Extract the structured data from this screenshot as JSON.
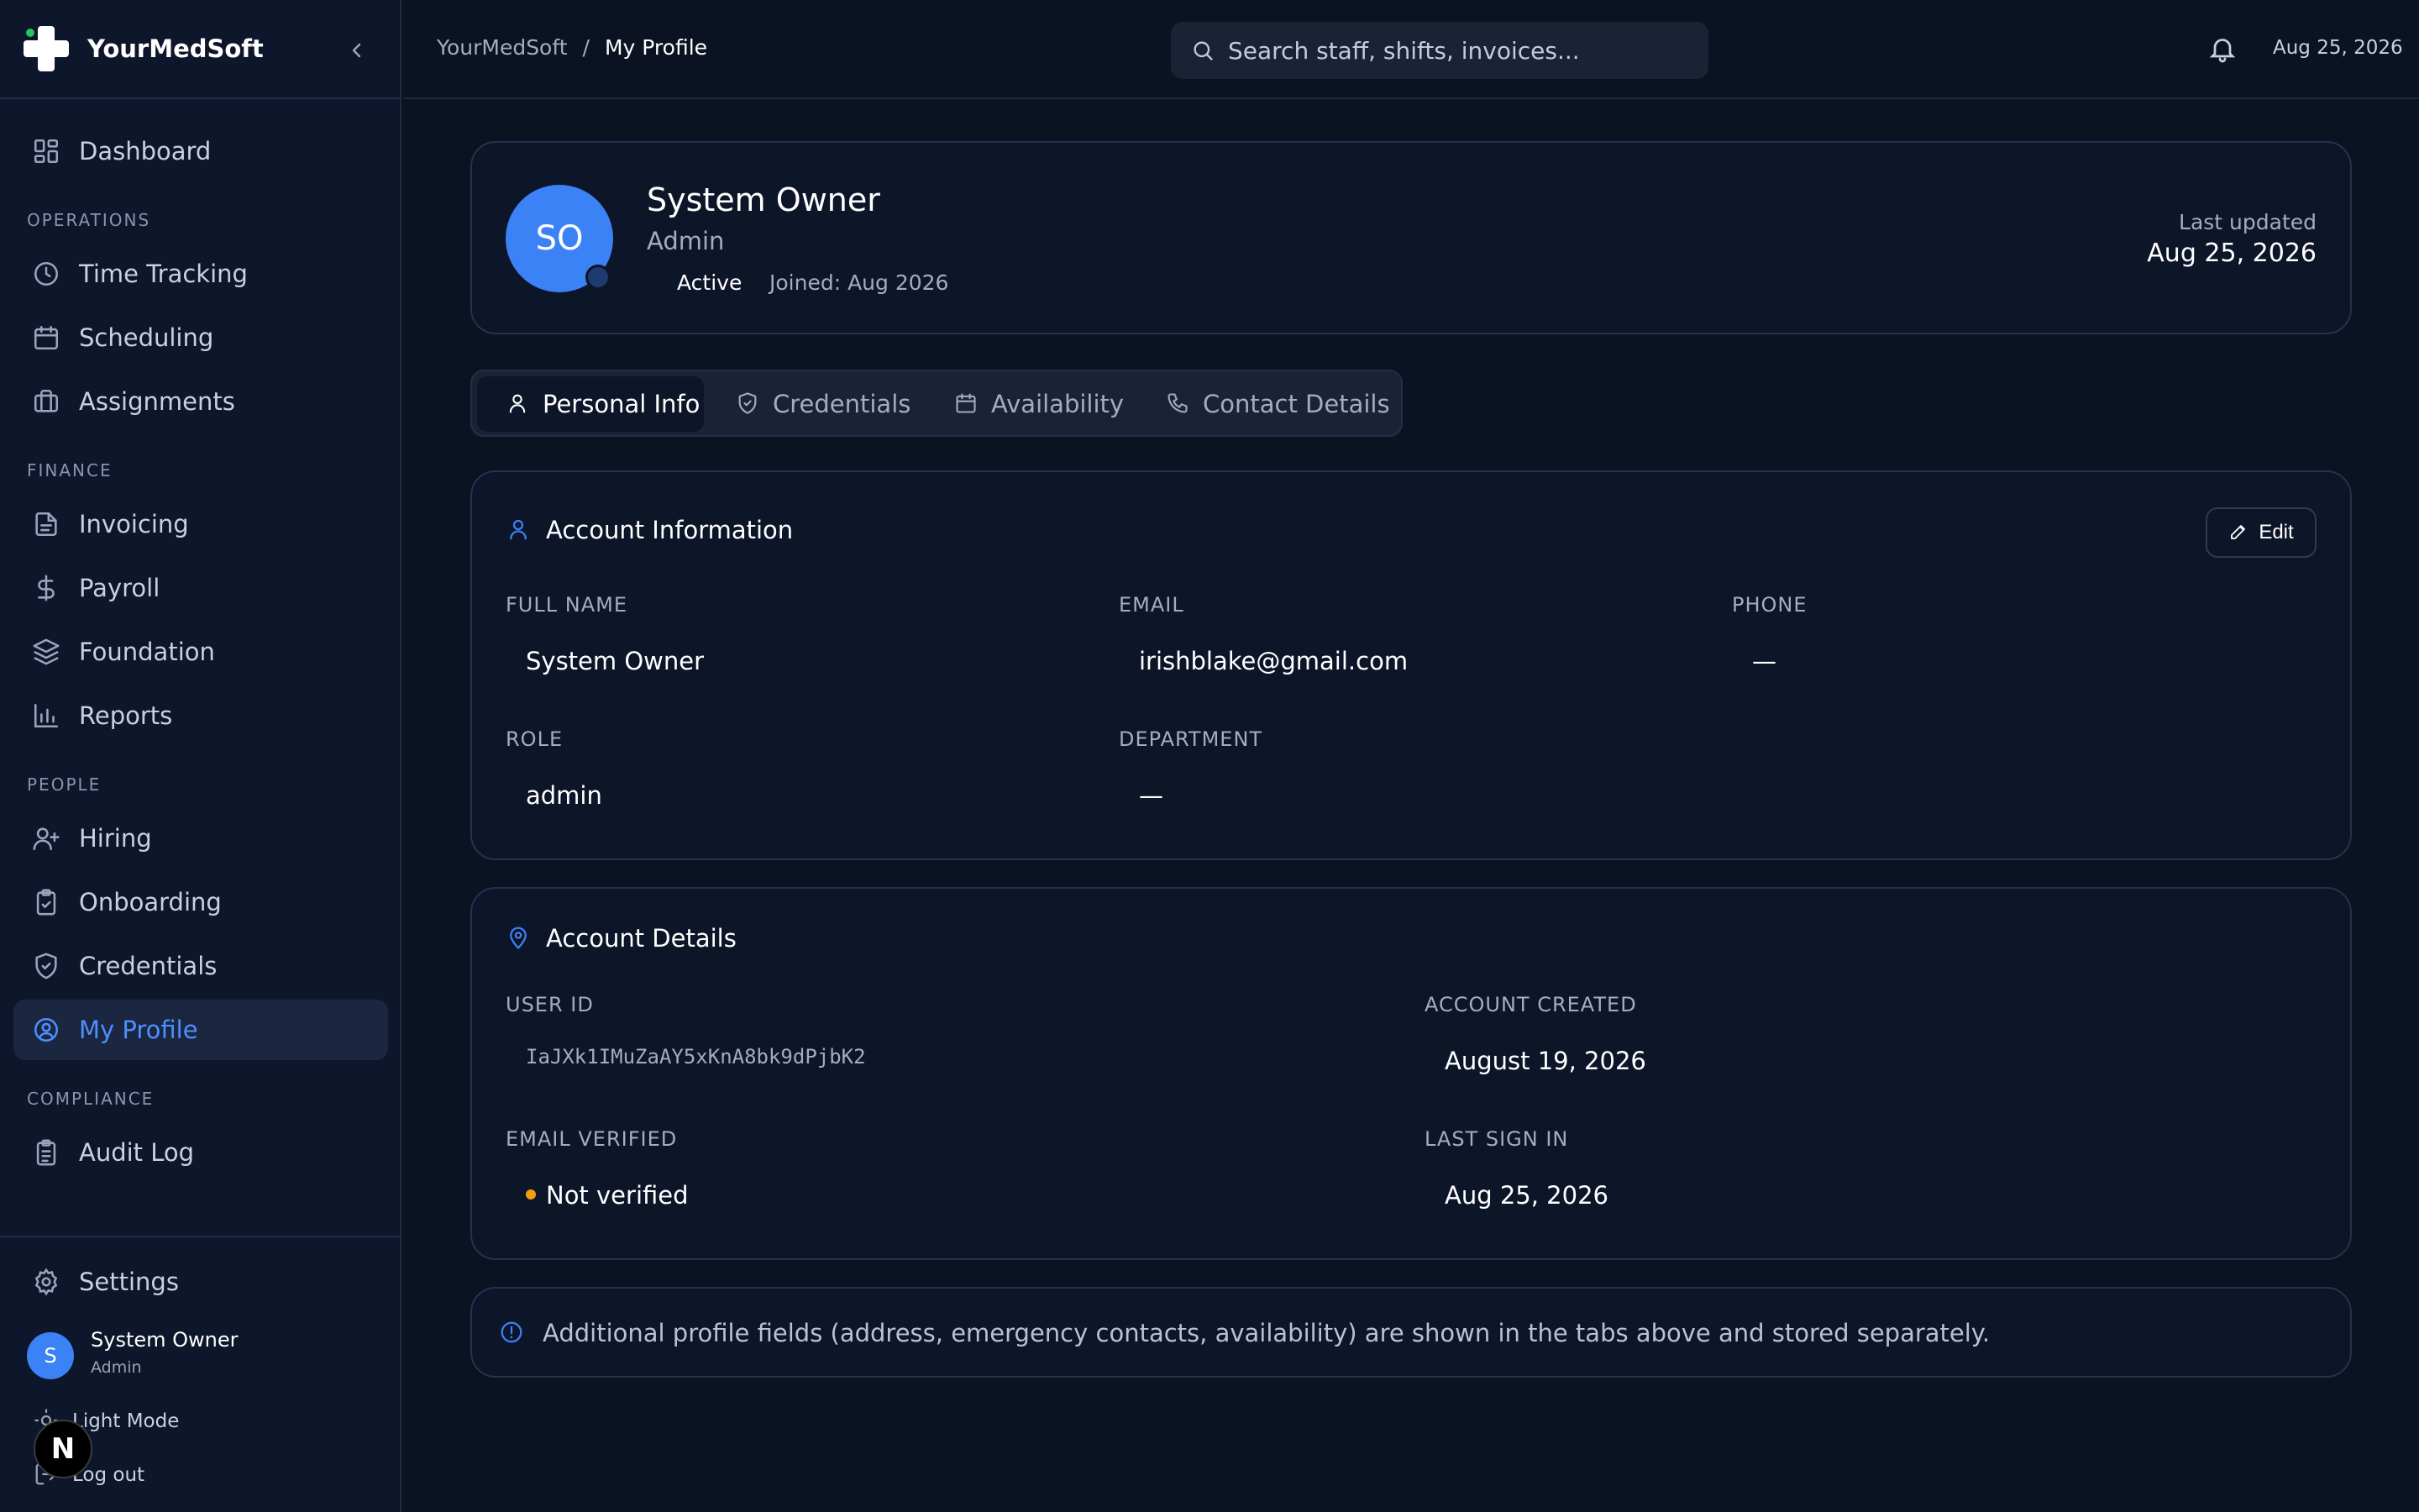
{
  "brand": {
    "name": "YourMedSoft"
  },
  "sidebar": {
    "items": [
      {
        "label": "Dashboard",
        "icon": "dashboard-icon"
      },
      {
        "label": "Time Tracking",
        "icon": "clock-icon"
      },
      {
        "label": "Scheduling",
        "icon": "calendar-icon"
      },
      {
        "label": "Assignments",
        "icon": "briefcase-icon"
      },
      {
        "label": "Invoicing",
        "icon": "file-text-icon"
      },
      {
        "label": "Payroll",
        "icon": "dollar-icon"
      },
      {
        "label": "Foundation",
        "icon": "layers-icon"
      },
      {
        "label": "Reports",
        "icon": "bar-chart-icon"
      },
      {
        "label": "Hiring",
        "icon": "user-plus-icon"
      },
      {
        "label": "Onboarding",
        "icon": "clipboard-check-icon"
      },
      {
        "label": "Credentials",
        "icon": "shield-check-icon"
      },
      {
        "label": "My Profile",
        "icon": "user-circle-icon",
        "active": true
      },
      {
        "label": "Audit Log",
        "icon": "clipboard-list-icon"
      }
    ],
    "sections": {
      "operations": "OPERATIONS",
      "finance": "FINANCE",
      "people": "PEOPLE",
      "compliance": "COMPLIANCE"
    },
    "settings_label": "Settings",
    "user": {
      "initial": "S",
      "name": "System Owner",
      "role": "Admin"
    },
    "light_mode_label": "Light Mode",
    "logout_label": "Log out",
    "badge": "N"
  },
  "topbar": {
    "breadcrumb": {
      "root": "YourMedSoft",
      "sep": "/",
      "current": "My Profile"
    },
    "search_placeholder": "Search staff, shifts, invoices...",
    "date": "Aug 25, 2026"
  },
  "profile": {
    "initials": "SO",
    "name": "System Owner",
    "role": "Admin",
    "status": "Active",
    "joined": "Joined: Aug 2026",
    "last_updated_label": "Last updated",
    "last_updated_value": "Aug 25, 2026"
  },
  "tabs": [
    {
      "label": "Personal Info",
      "icon": "user-icon",
      "active": true
    },
    {
      "label": "Credentials",
      "icon": "shield-check-icon"
    },
    {
      "label": "Availability",
      "icon": "calendar-icon"
    },
    {
      "label": "Contact Details",
      "icon": "phone-icon"
    }
  ],
  "account_info": {
    "title": "Account Information",
    "edit_label": "Edit",
    "full_name": {
      "label": "FULL NAME",
      "value": "System Owner"
    },
    "email": {
      "label": "EMAIL",
      "value": "irishblake@gmail.com"
    },
    "phone": {
      "label": "PHONE",
      "value": "—"
    },
    "role": {
      "label": "ROLE",
      "value": "admin"
    },
    "department": {
      "label": "DEPARTMENT",
      "value": "—"
    }
  },
  "account_details": {
    "title": "Account Details",
    "user_id": {
      "label": "USER ID",
      "value": "IaJXk1IMuZaAY5xKnA8bk9dPjbK2"
    },
    "account_created": {
      "label": "ACCOUNT CREATED",
      "value": "August 19, 2026"
    },
    "email_verified": {
      "label": "EMAIL VERIFIED",
      "value": "Not verified"
    },
    "last_sign_in": {
      "label": "LAST SIGN IN",
      "value": "Aug 25, 2026"
    }
  },
  "note": "Additional profile fields (address, emergency contacts, availability) are shown in the tabs above and stored separately.",
  "colors": {
    "accent": "#3b82f6",
    "background": "#0b1222",
    "warning": "#f59e0b"
  }
}
